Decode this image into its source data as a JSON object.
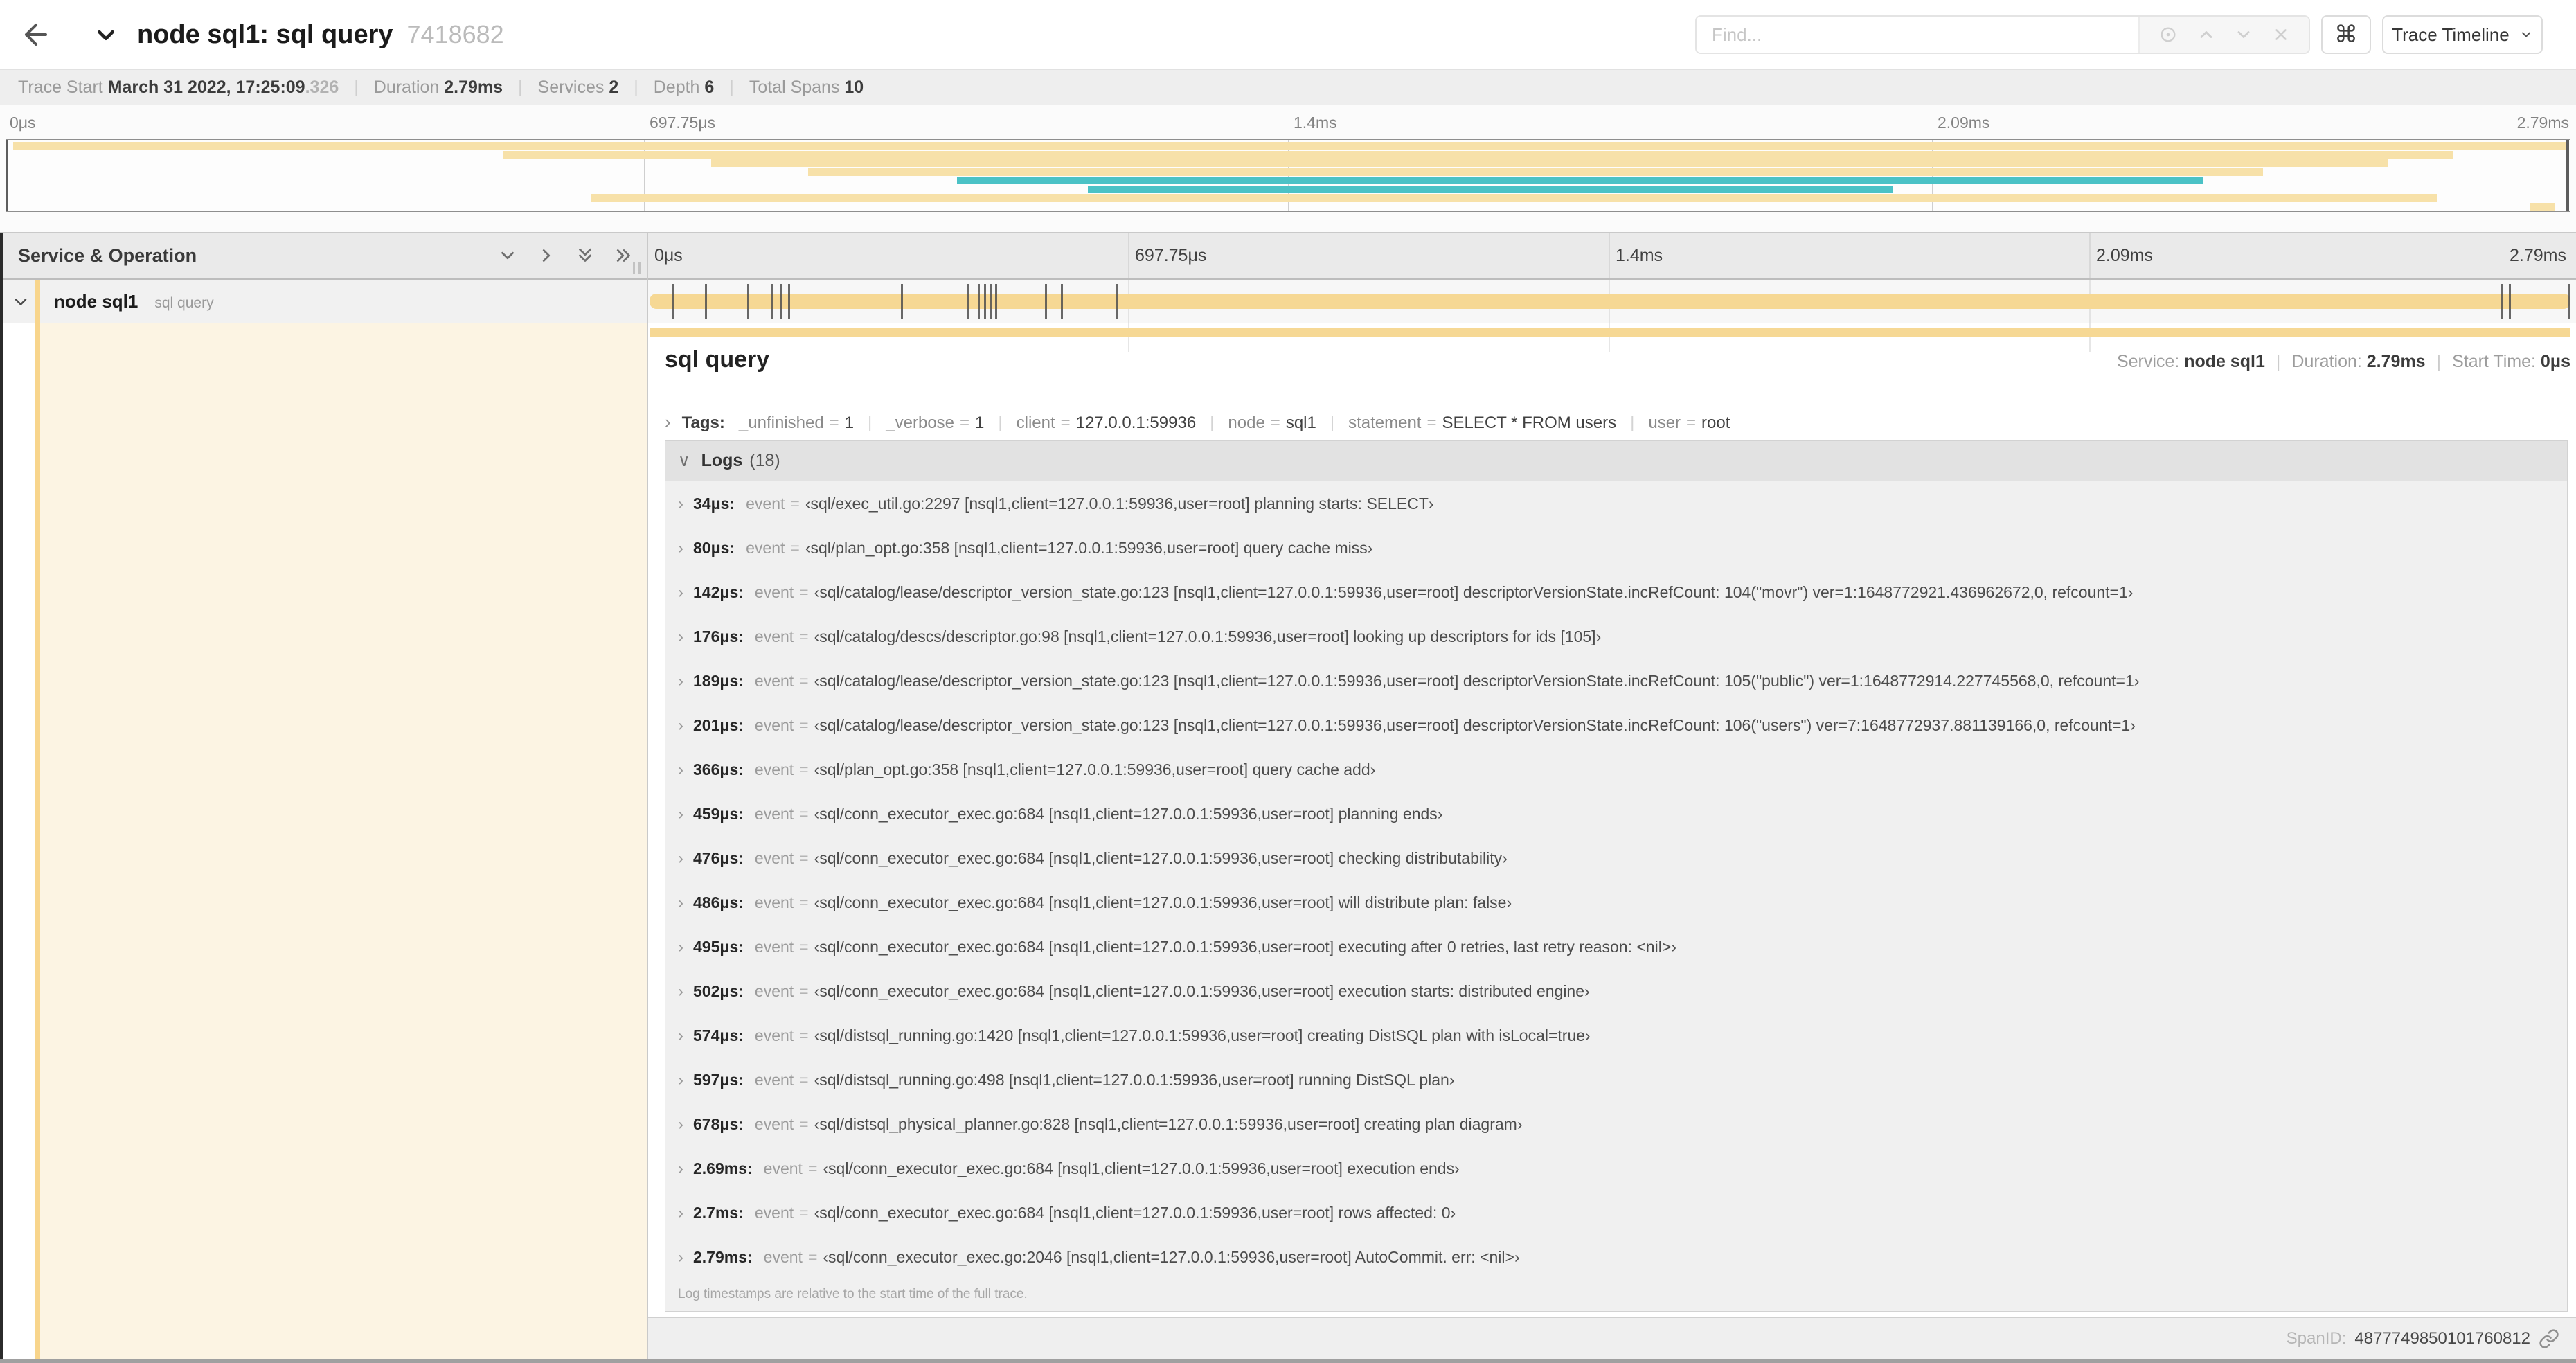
{
  "app": {
    "title": "node sql1: sql query",
    "trace_id": "7418682"
  },
  "toolbar": {
    "find_placeholder": "Find...",
    "shortcut_glyph": "⌘",
    "view_mode": "Trace Timeline"
  },
  "summary": {
    "items": [
      {
        "label": "Trace Start",
        "value": "March 31 2022, 17:25:09",
        "suffix": ".326"
      },
      {
        "label": "Duration",
        "value": "2.79ms"
      },
      {
        "label": "Services",
        "value": "2"
      },
      {
        "label": "Depth",
        "value": "6"
      },
      {
        "label": "Total Spans",
        "value": "10"
      }
    ]
  },
  "minimap": {
    "axis_ticks": [
      "0μs",
      "697.75μs",
      "1.4ms",
      "2.09ms",
      "2.79ms"
    ],
    "bars": [
      {
        "color": "tan",
        "left": 0.3,
        "width": 99.5
      },
      {
        "color": "tan",
        "left": 19.4,
        "width": 76.0
      },
      {
        "color": "tan",
        "left": 27.5,
        "width": 65.4
      },
      {
        "color": "tan",
        "left": 31.3,
        "width": 56.7
      },
      {
        "color": "teal",
        "left": 37.1,
        "width": 48.6
      },
      {
        "color": "teal",
        "left": 42.2,
        "width": 31.4
      },
      {
        "color": "tan",
        "left": 22.8,
        "width": 72.0
      },
      {
        "color": "tan",
        "left": 98.4,
        "width": 1.0
      }
    ]
  },
  "timeline": {
    "column_header": "Service & Operation",
    "ticks": [
      "0μs",
      "697.75μs",
      "1.4ms",
      "2.09ms",
      "2.79ms"
    ],
    "span": {
      "service": "node sql1",
      "operation": "sql query",
      "log_marker_percents": [
        1.2,
        2.9,
        5.1,
        6.3,
        6.8,
        7.2,
        13.1,
        16.5,
        17.1,
        17.4,
        17.7,
        18.0,
        20.6,
        21.4,
        24.3,
        96.4,
        96.8,
        99.85
      ]
    }
  },
  "detail": {
    "title": "sql query",
    "meta": [
      {
        "label": "Service:",
        "value": "node sql1"
      },
      {
        "label": "Duration:",
        "value": "2.79ms"
      },
      {
        "label": "Start Time:",
        "value": "0μs"
      }
    ],
    "tags": {
      "label": "Tags:",
      "items": [
        {
          "key": "_unfinished",
          "value": "1"
        },
        {
          "key": "_verbose",
          "value": "1"
        },
        {
          "key": "client",
          "value": "127.0.0.1:59936"
        },
        {
          "key": "node",
          "value": "sql1"
        },
        {
          "key": "statement",
          "value": "SELECT * FROM users"
        },
        {
          "key": "user",
          "value": "root"
        }
      ]
    },
    "logs": {
      "title": "Logs",
      "count": "(18)",
      "entries": [
        {
          "time": "34μs:",
          "key": "event",
          "value": "‹sql/exec_util.go:2297 [nsql1,client=127.0.0.1:59936,user=root] planning starts: SELECT›"
        },
        {
          "time": "80μs:",
          "key": "event",
          "value": "‹sql/plan_opt.go:358 [nsql1,client=127.0.0.1:59936,user=root] query cache miss›"
        },
        {
          "time": "142μs:",
          "key": "event",
          "value": "‹sql/catalog/lease/descriptor_version_state.go:123 [nsql1,client=127.0.0.1:59936,user=root] descriptorVersionState.incRefCount: 104(\"movr\") ver=1:1648772921.436962672,0, refcount=1›"
        },
        {
          "time": "176μs:",
          "key": "event",
          "value": "‹sql/catalog/descs/descriptor.go:98 [nsql1,client=127.0.0.1:59936,user=root] looking up descriptors for ids [105]›"
        },
        {
          "time": "189μs:",
          "key": "event",
          "value": "‹sql/catalog/lease/descriptor_version_state.go:123 [nsql1,client=127.0.0.1:59936,user=root] descriptorVersionState.incRefCount: 105(\"public\") ver=1:1648772914.227745568,0, refcount=1›"
        },
        {
          "time": "201μs:",
          "key": "event",
          "value": "‹sql/catalog/lease/descriptor_version_state.go:123 [nsql1,client=127.0.0.1:59936,user=root] descriptorVersionState.incRefCount: 106(\"users\") ver=7:1648772937.881139166,0, refcount=1›"
        },
        {
          "time": "366μs:",
          "key": "event",
          "value": "‹sql/plan_opt.go:358 [nsql1,client=127.0.0.1:59936,user=root] query cache add›"
        },
        {
          "time": "459μs:",
          "key": "event",
          "value": "‹sql/conn_executor_exec.go:684 [nsql1,client=127.0.0.1:59936,user=root] planning ends›"
        },
        {
          "time": "476μs:",
          "key": "event",
          "value": "‹sql/conn_executor_exec.go:684 [nsql1,client=127.0.0.1:59936,user=root] checking distributability›"
        },
        {
          "time": "486μs:",
          "key": "event",
          "value": "‹sql/conn_executor_exec.go:684 [nsql1,client=127.0.0.1:59936,user=root] will distribute plan: false›"
        },
        {
          "time": "495μs:",
          "key": "event",
          "value": "‹sql/conn_executor_exec.go:684 [nsql1,client=127.0.0.1:59936,user=root] executing after 0 retries, last retry reason: <nil>›"
        },
        {
          "time": "502μs:",
          "key": "event",
          "value": "‹sql/conn_executor_exec.go:684 [nsql1,client=127.0.0.1:59936,user=root] execution starts: distributed engine›"
        },
        {
          "time": "574μs:",
          "key": "event",
          "value": "‹sql/distsql_running.go:1420 [nsql1,client=127.0.0.1:59936,user=root] creating DistSQL plan with isLocal=true›"
        },
        {
          "time": "597μs:",
          "key": "event",
          "value": "‹sql/distsql_running.go:498 [nsql1,client=127.0.0.1:59936,user=root] running DistSQL plan›"
        },
        {
          "time": "678μs:",
          "key": "event",
          "value": "‹sql/distsql_physical_planner.go:828 [nsql1,client=127.0.0.1:59936,user=root] creating plan diagram›"
        },
        {
          "time": "2.69ms:",
          "key": "event",
          "value": "‹sql/conn_executor_exec.go:684 [nsql1,client=127.0.0.1:59936,user=root] execution ends›"
        },
        {
          "time": "2.7ms:",
          "key": "event",
          "value": "‹sql/conn_executor_exec.go:684 [nsql1,client=127.0.0.1:59936,user=root] rows affected: 0›"
        },
        {
          "time": "2.79ms:",
          "key": "event",
          "value": "‹sql/conn_executor_exec.go:2046 [nsql1,client=127.0.0.1:59936,user=root] AutoCommit. err: <nil>›"
        }
      ],
      "footnote": "Log timestamps are relative to the start time of the full trace."
    },
    "span_id_label": "SpanID:",
    "span_id": "4877749850101760812"
  }
}
